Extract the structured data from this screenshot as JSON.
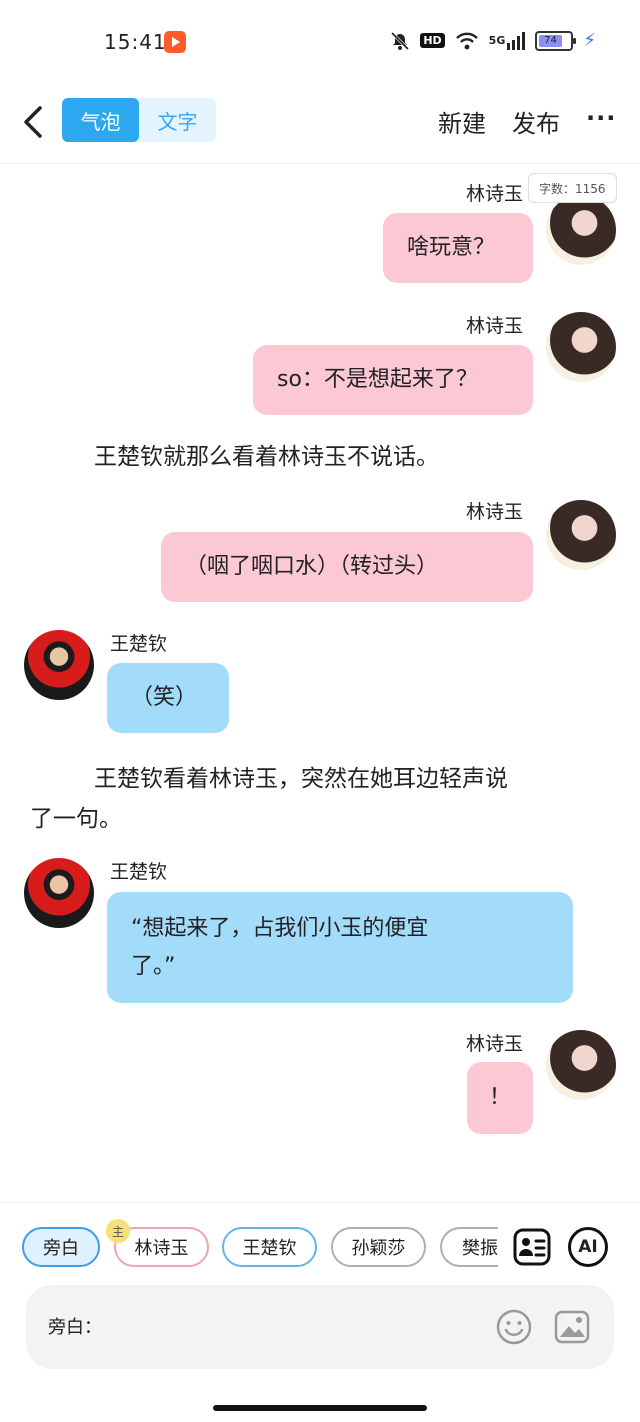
{
  "status_bar": {
    "time": "15:41",
    "hd_label": "HD",
    "network_label": "5G",
    "battery_level": "74",
    "battery_fraction": 0.74
  },
  "header": {
    "tabs": [
      {
        "label": "气泡",
        "active": true
      },
      {
        "label": "文字",
        "active": false
      }
    ],
    "new_label": "新建",
    "publish_label": "发布",
    "more_label": "···"
  },
  "chat": {
    "word_count": "字数：1156",
    "messages": [
      {
        "speaker": "林诗玉",
        "text": "啥玩意？"
      },
      {
        "speaker": "林诗玉",
        "text": "so：不是想起来了？"
      },
      {
        "narration": "王楚钦就那么看着林诗玉不说话。"
      },
      {
        "speaker": "林诗玉",
        "text": "（咽了咽口水）（转过头）"
      },
      {
        "speaker": "王楚钦",
        "text": "（笑）"
      },
      {
        "narration_line1": "王楚钦看着林诗玉，突然在她耳边轻声说",
        "narration_line2": "了一句。"
      },
      {
        "speaker": "王楚钦",
        "text_line1": "“想起来了，占我们小玉的便宜",
        "text_line2": "了。”"
      },
      {
        "speaker": "林诗玉",
        "text": "！"
      }
    ]
  },
  "panel": {
    "characters": [
      "旁白",
      "林诗玉",
      "王楚钦",
      "孙颖莎",
      "樊振东"
    ],
    "main_tag": "主",
    "ai_label": "AI",
    "input_prefix": "旁白：",
    "input_value": "",
    "input_placeholder": ""
  },
  "colors": {
    "accent_blue": "#2da7f0",
    "pink_bubble": "#fbc8d4",
    "blue_bubble": "#a3dbfb"
  }
}
